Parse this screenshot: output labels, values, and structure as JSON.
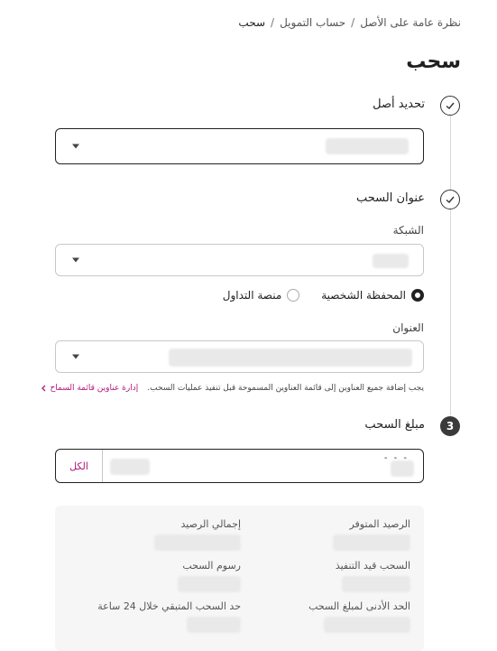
{
  "breadcrumb": {
    "items": [
      "نظرة عامة على الأصل",
      "حساب التمويل",
      "سحب"
    ],
    "separator": "/"
  },
  "page": {
    "title": "سحب"
  },
  "steps": [
    {
      "title": "تحديد أصل",
      "icon": "check-icon"
    },
    {
      "title": "عنوان السحب",
      "icon": "check-icon"
    },
    {
      "title": "مبلغ السحب",
      "number": "3"
    }
  ],
  "address_form": {
    "network_label": "الشبكة",
    "wallet_options": [
      "المحفظة الشخصية",
      "منصة التداول"
    ],
    "selected_wallet": "المحفظة الشخصية",
    "address_label": "العنوان",
    "whitelist_hint": "يجب إضافة جميع العناوين إلى قائمة العناوين المسموحة قبل تنفيذ عمليات السحب.",
    "manage_link": "إدارة عناوين قائمة السماح"
  },
  "amount": {
    "max_label": "الكل",
    "value_suffix": "- - -"
  },
  "summary": {
    "available_balance": "الرصيد المتوفر",
    "total_balance": "إجمالي الرصيد",
    "pending_withdrawal": "السحب قيد التنفيذ",
    "withdrawal_fee": "رسوم السحب",
    "min_amount": "الحد الأدنى لمبلغ السحب",
    "remaining_24h": "حد السحب المتبقي خلال 24 ساعة"
  },
  "colors": {
    "accent": "#b2177a",
    "step_active": "#3a3a3a"
  }
}
